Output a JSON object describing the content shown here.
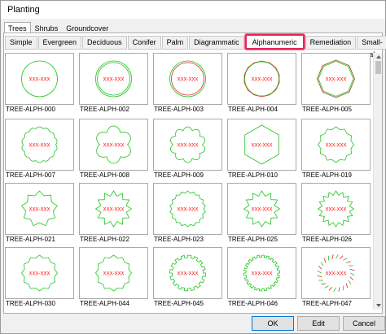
{
  "window": {
    "title": "Planting"
  },
  "top_tabs": [
    {
      "label": "Trees",
      "active": true
    },
    {
      "label": "Shrubs",
      "active": false
    },
    {
      "label": "Groundcover",
      "active": false
    }
  ],
  "sub_tabs": [
    {
      "label": "Simple",
      "active": false
    },
    {
      "label": "Evergreen",
      "active": false
    },
    {
      "label": "Deciduous",
      "active": false
    },
    {
      "label": "Conifer",
      "active": false
    },
    {
      "label": "Palm",
      "active": false
    },
    {
      "label": "Diagrammatic",
      "active": false
    },
    {
      "label": "Alphanumeric",
      "active": true,
      "highlighted": true
    },
    {
      "label": "Remediation",
      "active": false
    },
    {
      "label": "Small-scale",
      "active": false
    }
  ],
  "symbol_label": "XXX-XXX",
  "symbols": [
    {
      "name": "TREE-ALPH-000",
      "shape": "circle"
    },
    {
      "name": "TREE-ALPH-002",
      "shape": "double-circle"
    },
    {
      "name": "TREE-ALPH-003",
      "shape": "double-circle-red"
    },
    {
      "name": "TREE-ALPH-004",
      "shape": "polygon-red"
    },
    {
      "name": "TREE-ALPH-005",
      "shape": "octagon-brown"
    },
    {
      "name": "TREE-ALPH-007",
      "shape": "wavy-circle"
    },
    {
      "name": "TREE-ALPH-008",
      "shape": "lobed"
    },
    {
      "name": "TREE-ALPH-009",
      "shape": "lobed-small"
    },
    {
      "name": "TREE-ALPH-010",
      "shape": "pentagon"
    },
    {
      "name": "TREE-ALPH-019",
      "shape": "notched"
    },
    {
      "name": "TREE-ALPH-021",
      "shape": "notched-deep"
    },
    {
      "name": "TREE-ALPH-022",
      "shape": "spiked-in"
    },
    {
      "name": "TREE-ALPH-023",
      "shape": "scalloped"
    },
    {
      "name": "TREE-ALPH-025",
      "shape": "spiked-in"
    },
    {
      "name": "TREE-ALPH-026",
      "shape": "spiked-in-fine"
    },
    {
      "name": "TREE-ALPH-030",
      "shape": "notched-round"
    },
    {
      "name": "TREE-ALPH-044",
      "shape": "notched"
    },
    {
      "name": "TREE-ALPH-045",
      "shape": "castellated"
    },
    {
      "name": "TREE-ALPH-046",
      "shape": "castellated-fine"
    },
    {
      "name": "TREE-ALPH-047",
      "shape": "dashed-red"
    }
  ],
  "buttons": {
    "ok": "OK",
    "edit": "Edit",
    "cancel": "Cancel"
  },
  "colors": {
    "highlight": "#e8265a",
    "symbol_outline": "#22c322",
    "symbol_red": "#e02020",
    "symbol_brown": "#a0522d",
    "text_label": "#ff0000"
  }
}
